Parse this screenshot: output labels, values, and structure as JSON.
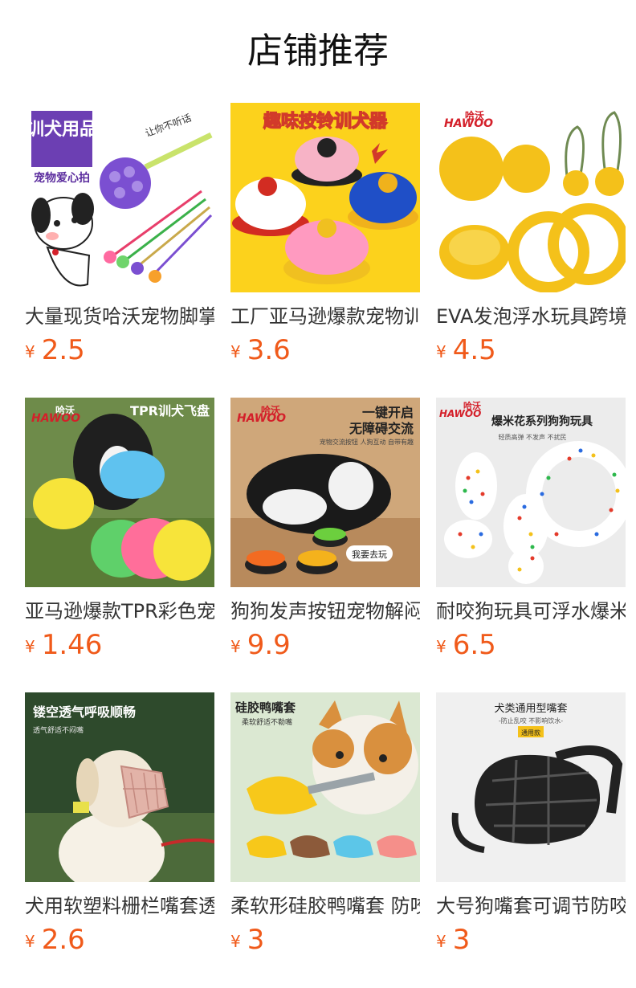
{
  "page": {
    "title": "店铺推荐"
  },
  "currency_symbol": "¥",
  "products": [
    {
      "name": "大量现货哈沃宠物脚掌训犬拍",
      "price": "2.5",
      "image": {
        "banner": "训犬用品",
        "sub": "宠物爱心拍",
        "tag": "让你不听话"
      }
    },
    {
      "name": "工厂亚马逊爆款宠物训练铃",
      "price": "3.6",
      "image": {
        "banner": "趣味按铃训犬器"
      }
    },
    {
      "name": "EVA发泡浮水玩具跨境爆款",
      "price": "4.5",
      "image": {
        "logo_cn": "哈沃",
        "logo_en": "HAWOO"
      }
    },
    {
      "name": "亚马逊爆款TPR彩色宠物飞盘",
      "price": "1.46",
      "image": {
        "logo_cn": "哈沃",
        "logo_en": "HAWOO",
        "banner": "TPR训犬飞盘"
      }
    },
    {
      "name": "狗狗发声按钮宠物解闷玩具",
      "price": "9.9",
      "image": {
        "logo_cn": "哈沃",
        "logo_en": "HAWOO",
        "line1": "一键开启",
        "line2": "无障碍交流",
        "sub": "宠物交流按钮 人狗互动 自带有趣",
        "button": "我要去玩"
      }
    },
    {
      "name": "耐咬狗玩具可浮水爆米花系列",
      "price": "6.5",
      "image": {
        "logo_cn": "哈沃",
        "logo_en": "HAWOO",
        "banner": "爆米花系列狗狗玩具",
        "sub": "轻质高弹 不发声 不扰民"
      }
    },
    {
      "name": "犬用软塑料栅栏嘴套透气",
      "price": "2.6",
      "image": {
        "banner": "镂空透气呼吸顺畅",
        "sub": "透气舒适不闷嘴"
      }
    },
    {
      "name": "柔软形硅胶鸭嘴套 防咬",
      "price": "3",
      "image": {
        "banner": "硅胶鸭嘴套",
        "sub": "柔软舒适不勒嘴"
      }
    },
    {
      "name": "大号狗嘴套可调节防咬防乱吃",
      "price": "3",
      "image": {
        "banner": "犬类通用型嘴套",
        "sub": "-防止乱咬 不影响饮水-",
        "tag": "通用款"
      }
    }
  ],
  "colors": {
    "price": "#f05a1a",
    "title": "#111111",
    "text": "#333333",
    "brand_red": "#d4202a"
  }
}
